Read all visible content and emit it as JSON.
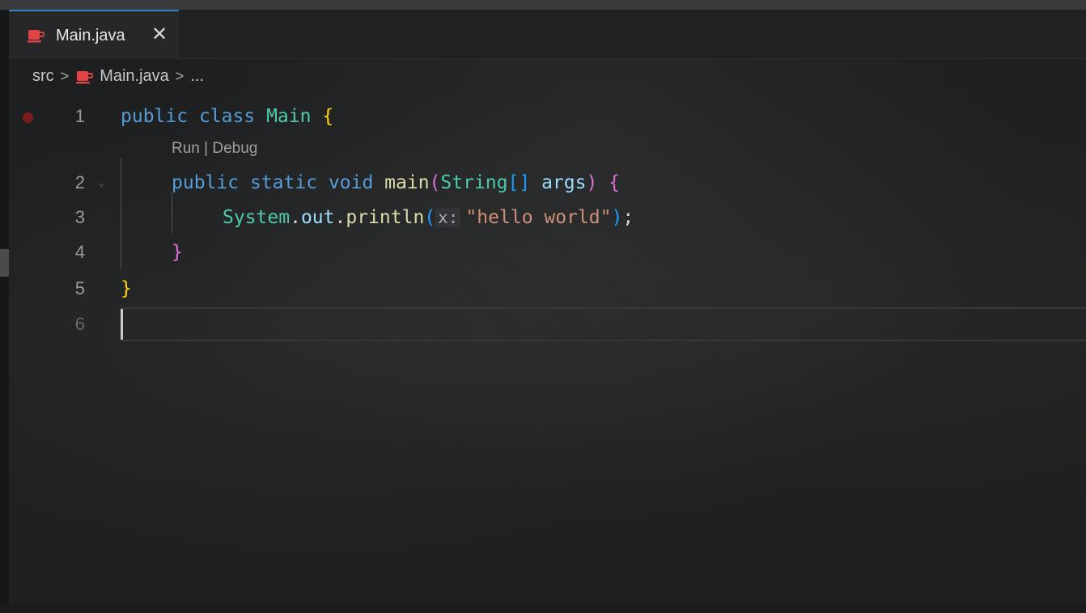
{
  "tab": {
    "label": "Main.java",
    "icon": "java-cup-icon",
    "close_symbol": "✕"
  },
  "breadcrumb": {
    "folder": "src",
    "file": "Main.java",
    "ellipsis": "..."
  },
  "codelens": {
    "text": "Run | Debug"
  },
  "lines": {
    "n1": "1",
    "n2": "2",
    "n3": "3",
    "n4": "4",
    "n5": "5",
    "n6": "6"
  },
  "code": {
    "l1_kw1": "public",
    "l1_kw2": "class",
    "l1_name": "Main",
    "l1_brace": "{",
    "l2_kw1": "public",
    "l2_kw2": "static",
    "l2_kw3": "void",
    "l2_fn": "main",
    "l2_paren_open": "(",
    "l2_type": "String",
    "l2_brackets": "[]",
    "l2_param": "args",
    "l2_paren_close": ")",
    "l2_brace": "{",
    "l3_obj": "System",
    "l3_field": "out",
    "l3_fn": "println",
    "l3_paren_open": "(",
    "l3_hint": "x:",
    "l3_str": "\"hello world\"",
    "l3_paren_close": ")",
    "l3_semi": ";",
    "l4_brace": "}",
    "l5_brace": "}"
  },
  "colors": {
    "keyword": "#569cd6",
    "type": "#4ec9b0",
    "function": "#dcdcaa",
    "parameter": "#9cdcfe",
    "string": "#ce9178",
    "brace_level1": "#ffd700",
    "brace_level2": "#da70d6",
    "breakpoint": "#7a1c1c",
    "tab_accent": "#3d7cc9"
  }
}
